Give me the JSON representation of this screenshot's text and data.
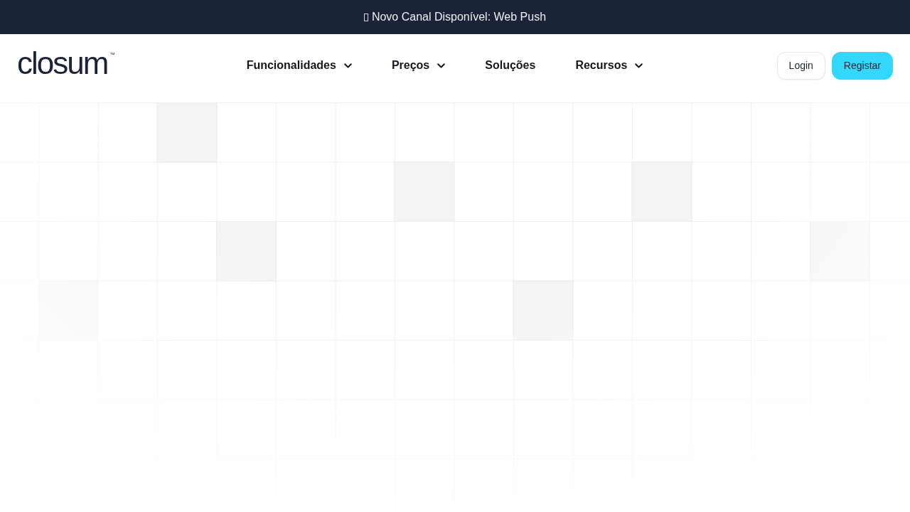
{
  "announcement": {
    "text": "Novo Canal Disponível: Web Push"
  },
  "logo": {
    "text": "closum$^{™}$"
  },
  "nav": {
    "items": [
      {
        "label": "Funcionalidades",
        "dropdown": true
      },
      {
        "label": "Preços",
        "dropdown": true
      },
      {
        "label": "Soluções",
        "dropdown": false
      },
      {
        "label": "Recursos",
        "dropdown": true
      }
    ]
  },
  "actions": [
    {
      "label": "Login",
      "kind": "secondary"
    },
    {
      "label": "Registar",
      "kind": "primary"
    }
  ]
}
